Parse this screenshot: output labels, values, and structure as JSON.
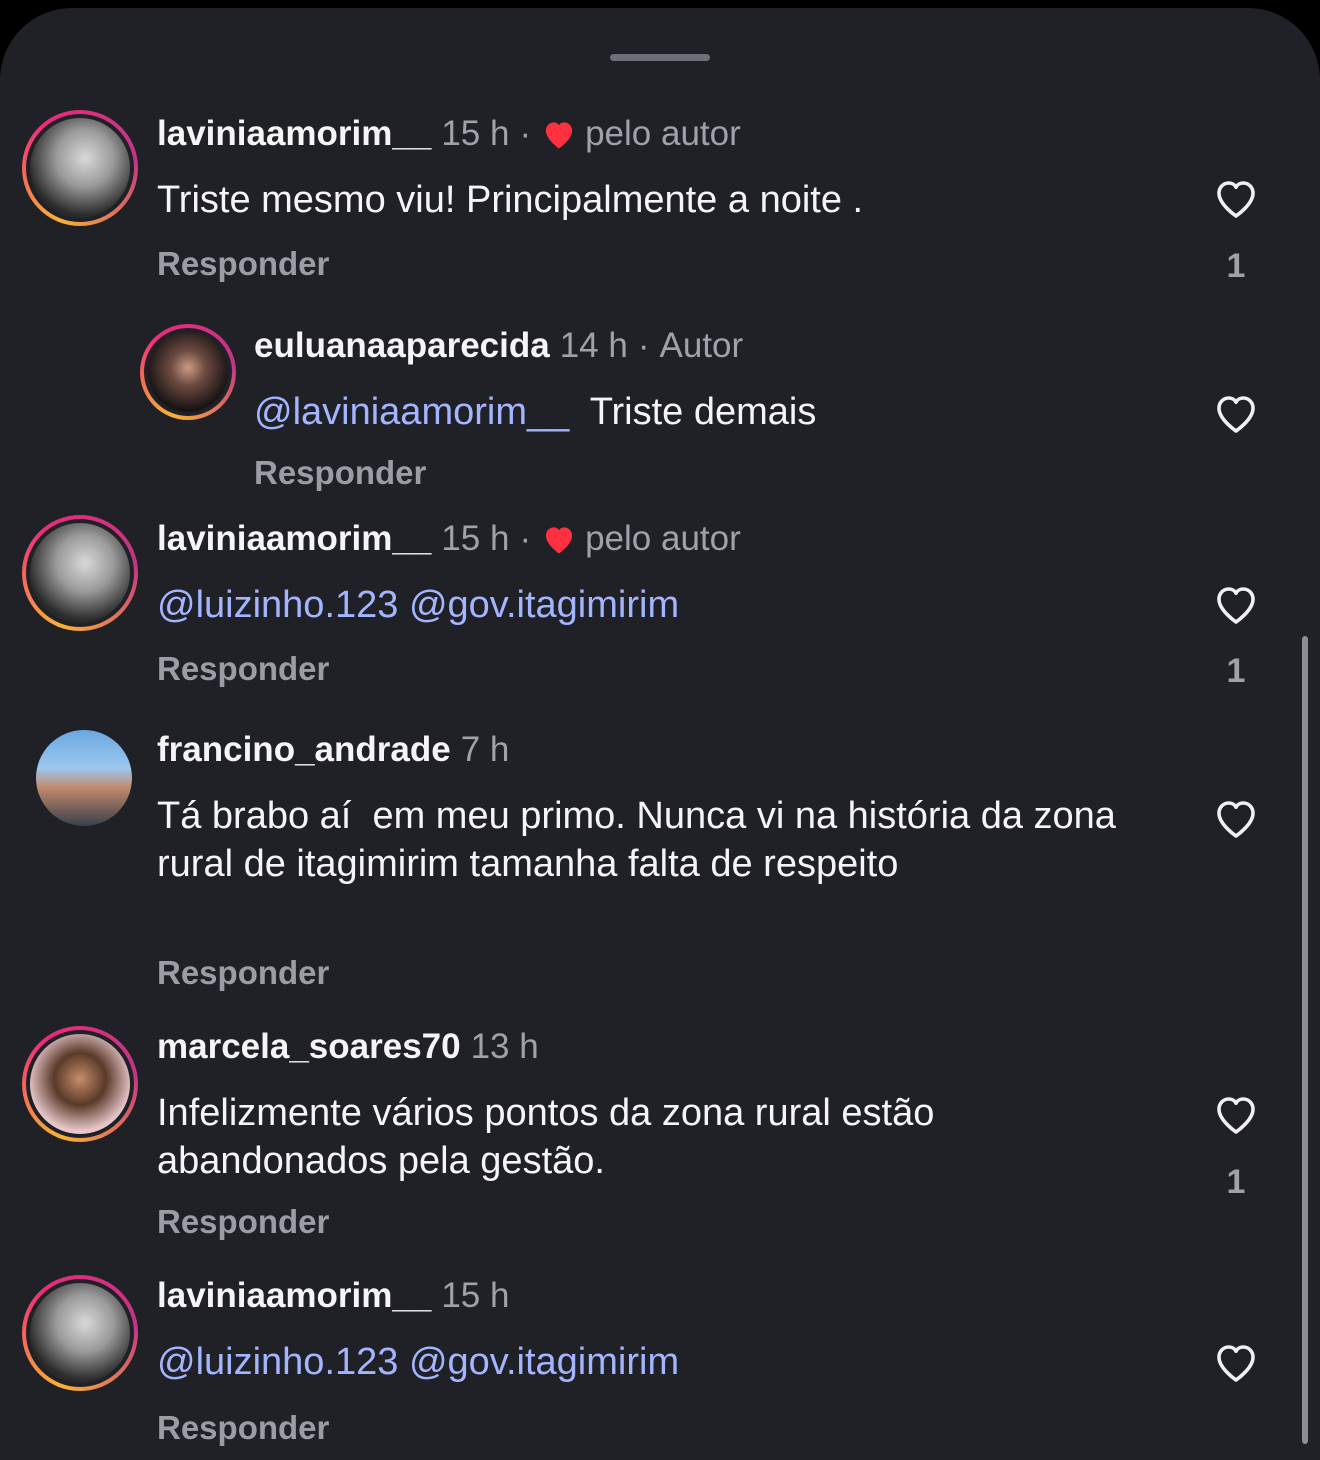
{
  "reply_label": "Responder",
  "comments": [
    {
      "username": "laviniaamorim__",
      "time": "15 h",
      "liked_by": "pelo autor",
      "text": "Triste mesmo viu! Principalmente a noite .",
      "likes": "1"
    },
    {
      "username": "euluanaaparecida",
      "time": "14 h",
      "badge": "Autor",
      "mention": "@laviniaamorim__",
      "text": "Triste demais"
    },
    {
      "username": "laviniaamorim__",
      "time": "15 h",
      "liked_by": "pelo autor",
      "mentions": "@luizinho.123 @gov.itagimirim",
      "likes": "1"
    },
    {
      "username": "francino_andrade",
      "time": "7 h",
      "text": "Tá brabo aí  em meu primo. Nunca vi na história da zona rural de itagimirim tamanha falta de respeito"
    },
    {
      "username": "marcela_soares70",
      "time": "13 h",
      "text": "Infelizmente vários pontos da zona rural estão abandonados pela gestão.",
      "likes": "1"
    },
    {
      "username": "laviniaamorim__",
      "time": "15 h",
      "mentions": "@luizinho.123 @gov.itagimirim"
    }
  ],
  "colors": {
    "background": "#202127",
    "mention": "#a3b5ff",
    "heart_red": "#ff3040",
    "story_ring": "#ee2a7b"
  },
  "icons": {
    "like": "heart-outline-icon",
    "author_like": "heart-filled-icon"
  }
}
